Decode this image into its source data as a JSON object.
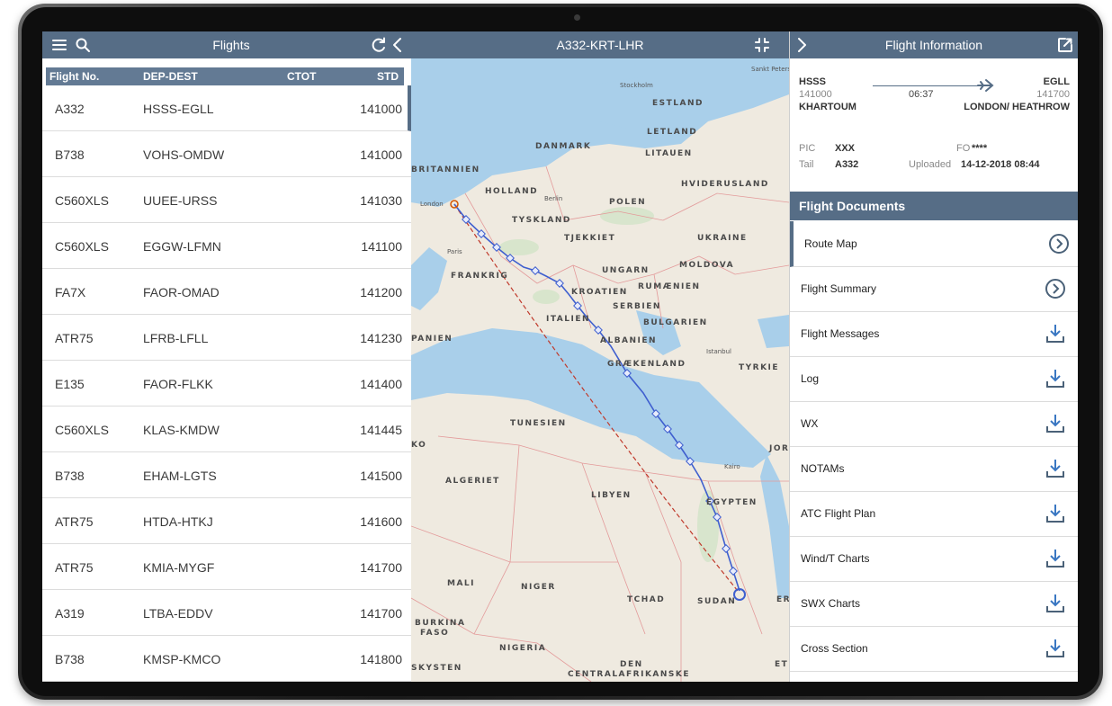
{
  "left_panel": {
    "title": "Flights",
    "columns": [
      "Flight No.",
      "DEP-DEST",
      "CTOT",
      "STD"
    ],
    "rows": [
      {
        "flight": "A332",
        "route": "HSSS-EGLL",
        "std": "141000"
      },
      {
        "flight": "B738",
        "route": "VOHS-OMDW",
        "std": "141000"
      },
      {
        "flight": "C560XLS",
        "route": "UUEE-URSS",
        "std": "141030"
      },
      {
        "flight": "C560XLS",
        "route": "EGGW-LFMN",
        "std": "141100"
      },
      {
        "flight": "FA7X",
        "route": "FAOR-OMAD",
        "std": "141200"
      },
      {
        "flight": "ATR75",
        "route": "LFRB-LFLL",
        "std": "141230"
      },
      {
        "flight": "E135",
        "route": "FAOR-FLKK",
        "std": "141400"
      },
      {
        "flight": "C560XLS",
        "route": "KLAS-KMDW",
        "std": "141445"
      },
      {
        "flight": "B738",
        "route": "EHAM-LGTS",
        "std": "141500"
      },
      {
        "flight": "ATR75",
        "route": "HTDA-HTKJ",
        "std": "141600"
      },
      {
        "flight": "ATR75",
        "route": "KMIA-MYGF",
        "std": "141700"
      },
      {
        "flight": "A319",
        "route": "LTBA-EDDV",
        "std": "141700"
      },
      {
        "flight": "B738",
        "route": "KMSP-KMCO",
        "std": "141800"
      }
    ]
  },
  "map_panel": {
    "title": "A332-KRT-LHR",
    "labels": [
      "Sankt Peters",
      "Stockholm",
      "ESTLAND",
      "LETLAND",
      "DANMARK",
      "LITAUEN",
      "BRITANNIEN",
      "HOLLAND",
      "Berlin",
      "POLEN",
      "HVIDERUSLAND",
      "London",
      "TYSKLAND",
      "TJEKKIET",
      "UKRAINE",
      "Paris",
      "UNGARN",
      "MOLDOVA",
      "FRANKRIG",
      "KROATIEN",
      "RUMÆNIEN",
      "SERBIEN",
      "ITALIEN",
      "BULGARIEN",
      "PANIEN",
      "ALBANIEN",
      "Istanbul",
      "GRÆKENLAND",
      "TYRKIE",
      "TUNESIEN",
      "KO",
      "JORD",
      "Kairo",
      "ALGERIET",
      "LIBYEN",
      "EGYPTEN",
      "MALI",
      "NIGER",
      "TCHAD",
      "SUDAN",
      "ER",
      "BURKINA",
      "FASO",
      "NIGERIA",
      "SKYSTEN",
      "DEN",
      "CENTRALAFRIKANSKE",
      "ET"
    ]
  },
  "right_panel": {
    "title": "Flight Information",
    "dep_code": "HSSS",
    "dep_time": "141000",
    "dep_city": "KHARTOUM",
    "duration": "06:37",
    "arr_code": "EGLL",
    "arr_time": "141700",
    "arr_city": "LONDON/ HEATHROW",
    "pic_label": "PIC",
    "pic_value": "XXX",
    "fo_label": "FO",
    "fo_value": "****",
    "tail_label": "Tail",
    "tail_value": "A332",
    "uploaded_label": "Uploaded",
    "uploaded_value": "14-12-2018 08:44",
    "docs_header": "Flight Documents",
    "docs": [
      {
        "label": "Route Map",
        "icon": "chevron-circle-icon"
      },
      {
        "label": "Flight Summary",
        "icon": "chevron-circle-icon"
      },
      {
        "label": "Flight Messages",
        "icon": "download-icon"
      },
      {
        "label": "Log",
        "icon": "download-icon"
      },
      {
        "label": "WX",
        "icon": "download-icon"
      },
      {
        "label": "NOTAMs",
        "icon": "download-icon"
      },
      {
        "label": "ATC Flight Plan",
        "icon": "download-icon"
      },
      {
        "label": "Wind/T Charts",
        "icon": "download-icon"
      },
      {
        "label": "SWX Charts",
        "icon": "download-icon"
      },
      {
        "label": "Cross Section",
        "icon": "download-icon"
      }
    ]
  },
  "colors": {
    "header": "#566d86",
    "table_header": "#637a94",
    "route": "#3f5fcf",
    "great_circle": "#c0392b",
    "water": "#a9cfea",
    "land": "#efeae0"
  }
}
